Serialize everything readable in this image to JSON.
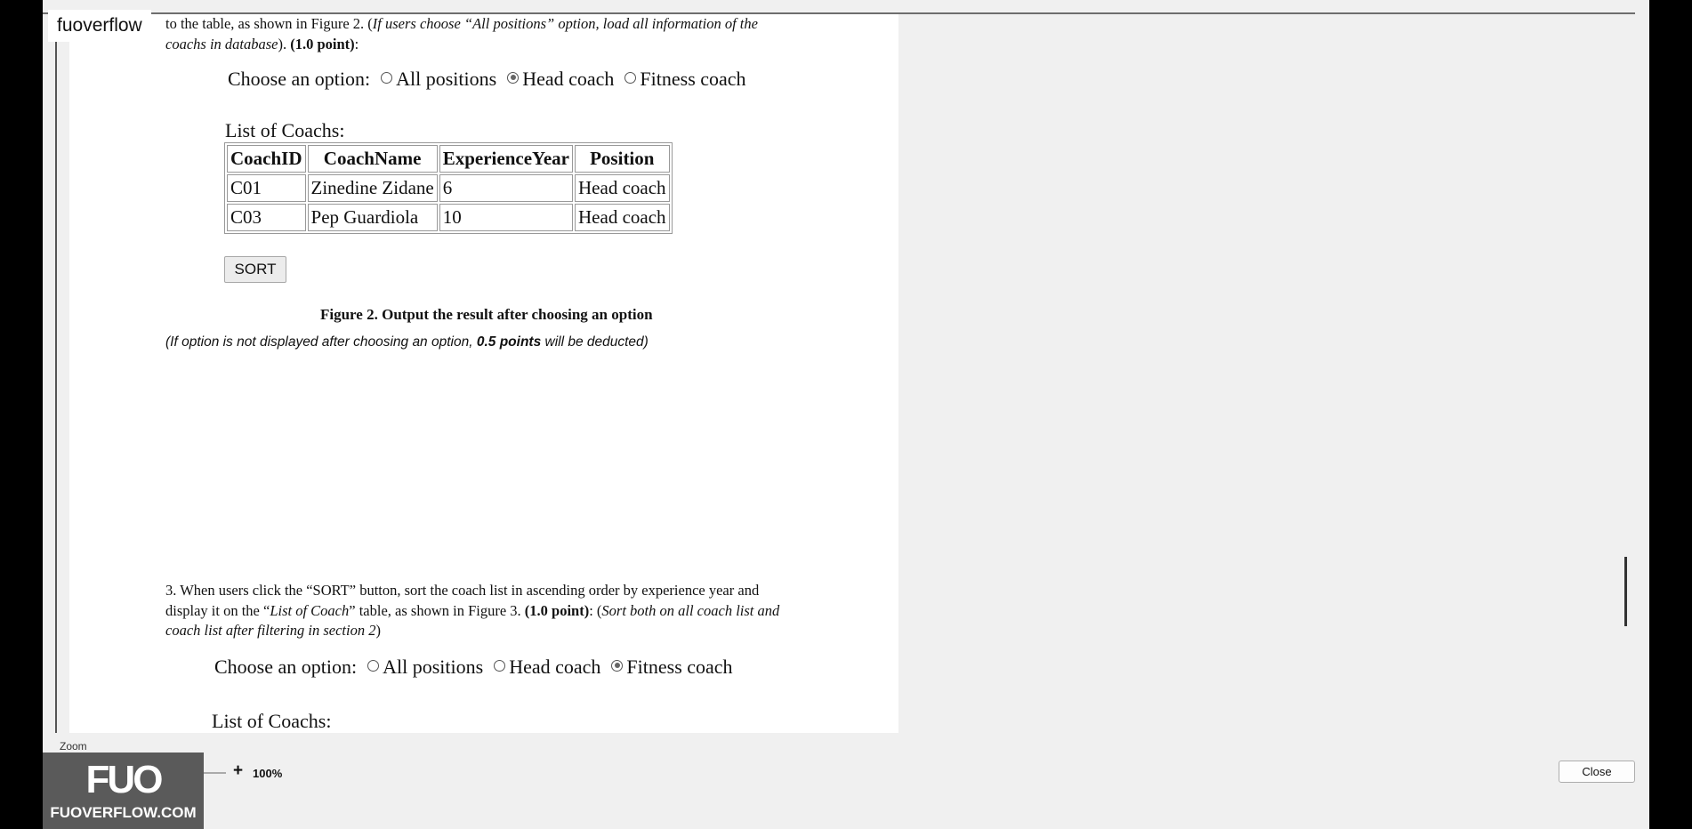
{
  "brand": {
    "tab_label": "fuoverflow"
  },
  "doc": {
    "intro_line1_prefix": "to the table, as shown in Figure 2. (",
    "intro_line1_italic": "If users choose “All positions” option, load all information of the",
    "intro_line2_italic": "coachs in database",
    "intro_line2_mid": "). ",
    "intro_line2_bold": "(1.0 point)",
    "intro_line2_suffix": ":",
    "choose_label": "Choose an option:",
    "options": [
      "All positions",
      "Head coach",
      "Fitness coach"
    ],
    "figure2": {
      "selected": "Head coach",
      "list_title": "List of Coachs:",
      "columns": [
        "CoachID",
        "CoachName",
        "ExperienceYear",
        "Position"
      ],
      "rows": [
        [
          "C01",
          "Zinedine Zidane",
          "6",
          "Head coach"
        ],
        [
          "C03",
          "Pep Guardiola",
          "10",
          "Head coach"
        ]
      ],
      "sort_button": "SORT",
      "caption": "Figure 2. Output the result after choosing an option"
    },
    "note_prefix": "(If option is not displayed after choosing an option, ",
    "note_bold": "0.5 points",
    "note_suffix": " will be deducted)",
    "section3_line1": "3. When users click the “SORT” button, sort the coach list in ascending order by experience year and",
    "section3_line2_prefix": "display it on the “",
    "section3_line2_italic": "List of Coach",
    "section3_line2_mid": "” table, as shown in Figure 3. ",
    "section3_line2_bold": "(1.0 point)",
    "section3_line2_colon": ": (",
    "section3_line2_italic2": "Sort both on all coach list and",
    "section3_line3_italic": "coach list after filtering in section 2",
    "section3_line3_suffix": ")",
    "figure3": {
      "selected": "Fitness coach",
      "list_title": "List of Coachs:"
    }
  },
  "zoombar": {
    "label": "Zoom",
    "minus": "-",
    "plus": "+",
    "value": "100%",
    "close": "Close"
  },
  "watermark": {
    "logo": "FUO",
    "text": "FUOVERFLOW.COM"
  }
}
